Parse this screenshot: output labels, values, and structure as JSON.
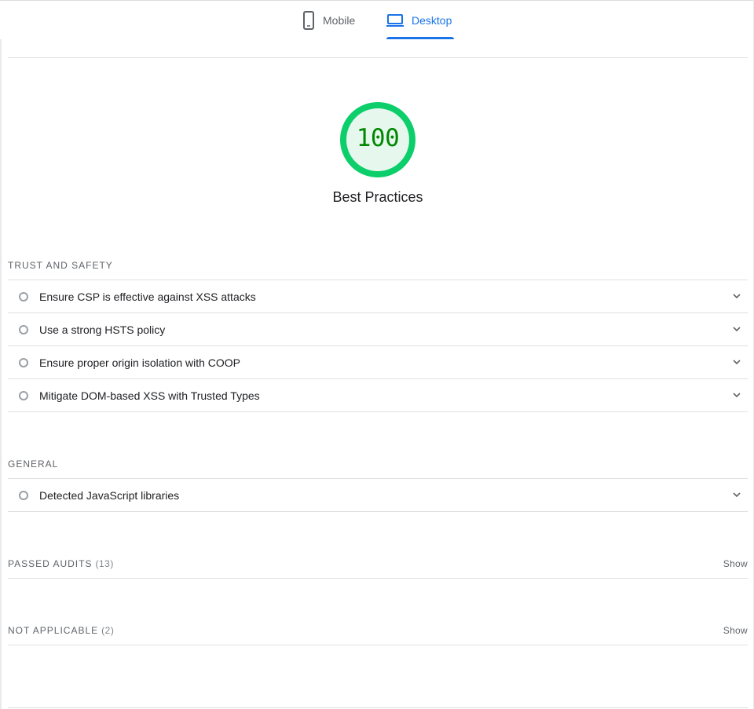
{
  "tabs": {
    "mobile": {
      "label": "Mobile",
      "icon": "mobile-phone-icon",
      "active": false
    },
    "desktop": {
      "label": "Desktop",
      "icon": "laptop-icon",
      "active": true
    }
  },
  "score": {
    "value": "100",
    "title": "Best Practices",
    "color": "#0cce6b",
    "text_color": "#008800",
    "fill": "#e6f7ee",
    "progress": 1.0
  },
  "groups": {
    "trust": {
      "title": "TRUST AND SAFETY",
      "audits": [
        {
          "label": "Ensure CSP is effective against XSS attacks"
        },
        {
          "label": "Use a strong HSTS policy"
        },
        {
          "label": "Ensure proper origin isolation with COOP"
        },
        {
          "label": "Mitigate DOM-based XSS with Trusted Types"
        }
      ]
    },
    "general": {
      "title": "GENERAL",
      "audits": [
        {
          "label": "Detected JavaScript libraries"
        }
      ]
    },
    "passed": {
      "title": "PASSED AUDITS",
      "count": "(13)",
      "toggle_label": "Show"
    },
    "not_applicable": {
      "title": "NOT APPLICABLE",
      "count": "(2)",
      "toggle_label": "Show"
    }
  },
  "colors": {
    "accent": "#1a73e8",
    "pass": "#0cce6b",
    "informative": "#9aa0a6"
  }
}
